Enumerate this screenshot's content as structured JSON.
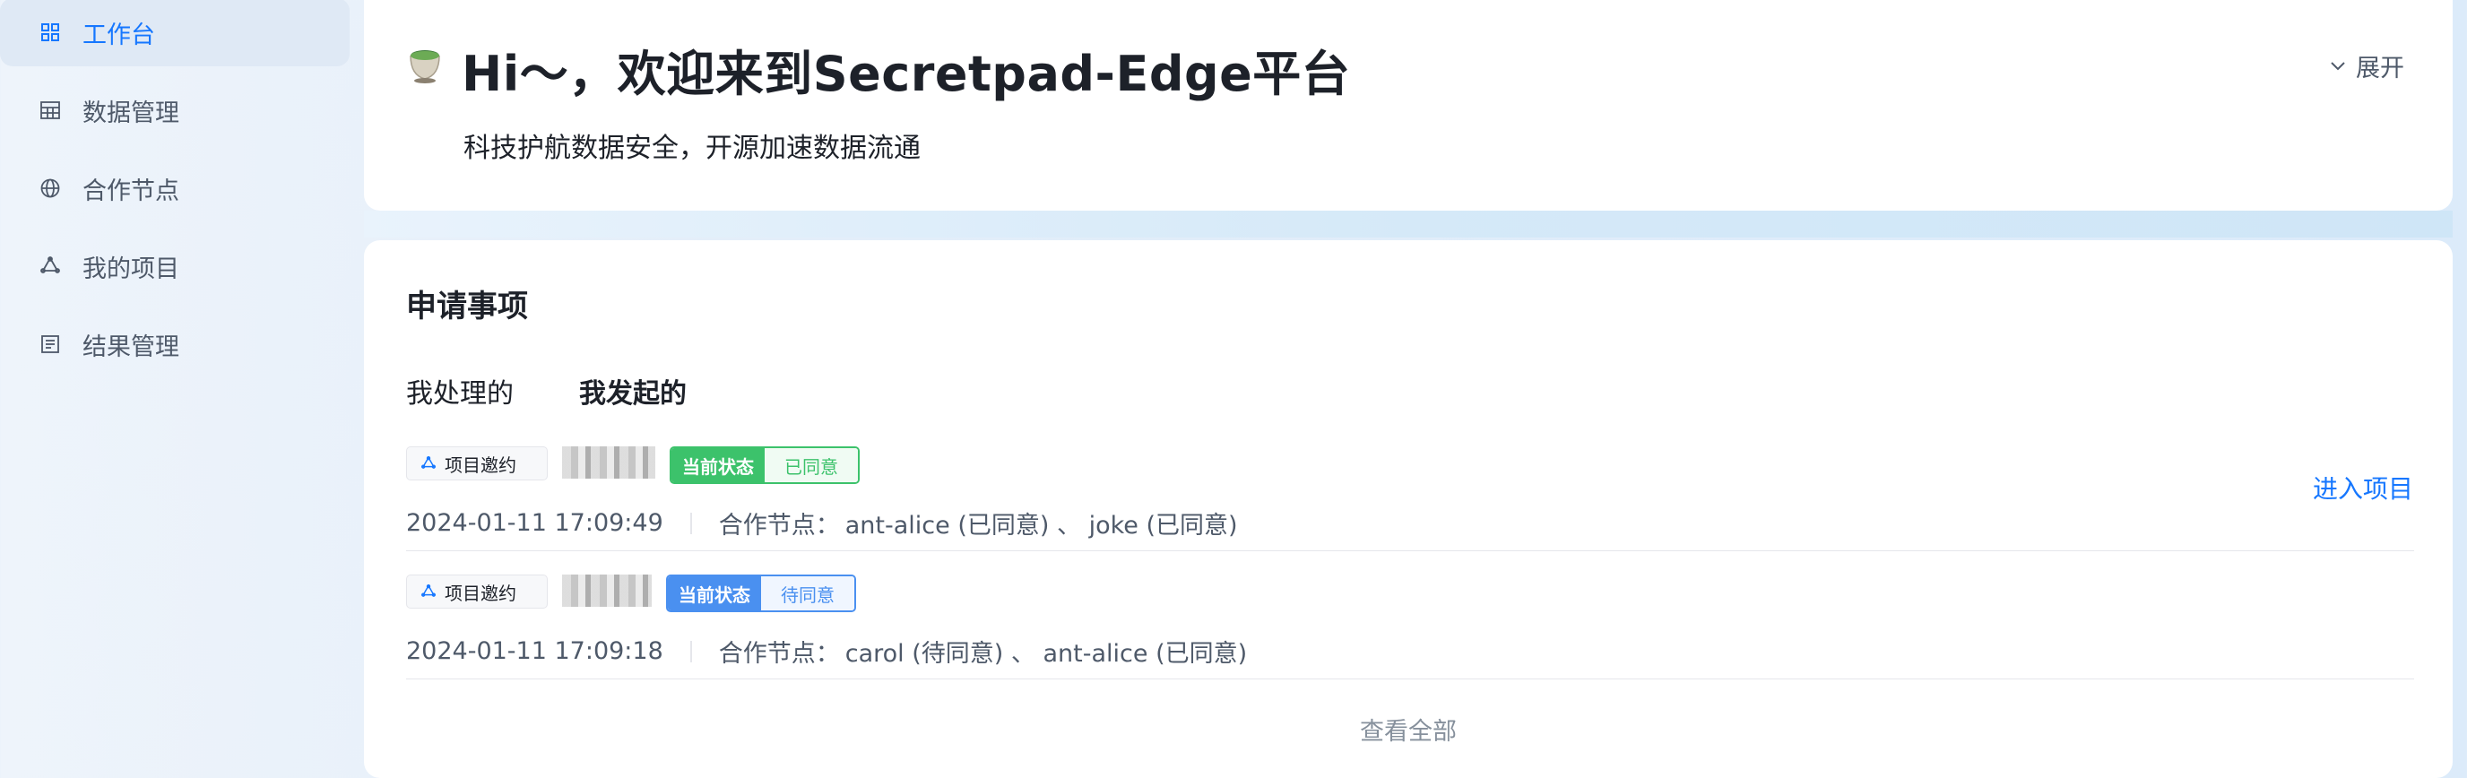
{
  "sidebar": {
    "items": [
      {
        "label": "工作台",
        "icon": "dashboard-icon",
        "active": true
      },
      {
        "label": "数据管理",
        "icon": "table-icon",
        "active": false
      },
      {
        "label": "合作节点",
        "icon": "globe-icon",
        "active": false
      },
      {
        "label": "我的项目",
        "icon": "project-icon",
        "active": false
      },
      {
        "label": "结果管理",
        "icon": "list-icon",
        "active": false
      }
    ]
  },
  "welcome": {
    "title": "Hi～，欢迎来到Secretpad-Edge平台",
    "subtitle": "科技护航数据安全，开源加速数据流通",
    "expand_label": "展开"
  },
  "applications": {
    "title": "申请事项",
    "tabs": [
      {
        "label": "我处理的",
        "active": false
      },
      {
        "label": "我发起的",
        "active": true
      }
    ],
    "rows": [
      {
        "type": "项目邀约",
        "status_key": "当前状态",
        "status_value": "已同意",
        "status_color": "#3cc26b",
        "time": "2024-01-11 17:09:49",
        "nodes_label": "合作节点：",
        "nodes": "ant-alice (已同意) 、 joke (已同意)",
        "action": "进入项目"
      },
      {
        "type": "项目邀约",
        "status_key": "当前状态",
        "status_value": "待同意",
        "status_color": "#4a90f0",
        "time": "2024-01-11 17:09:18",
        "nodes_label": "合作节点：",
        "nodes": "carol (待同意) 、 ant-alice (已同意)"
      }
    ],
    "view_all": "查看全部"
  },
  "colors": {
    "accent": "#1677ff",
    "approved": "#3cc26b",
    "pending": "#4a90f0"
  }
}
